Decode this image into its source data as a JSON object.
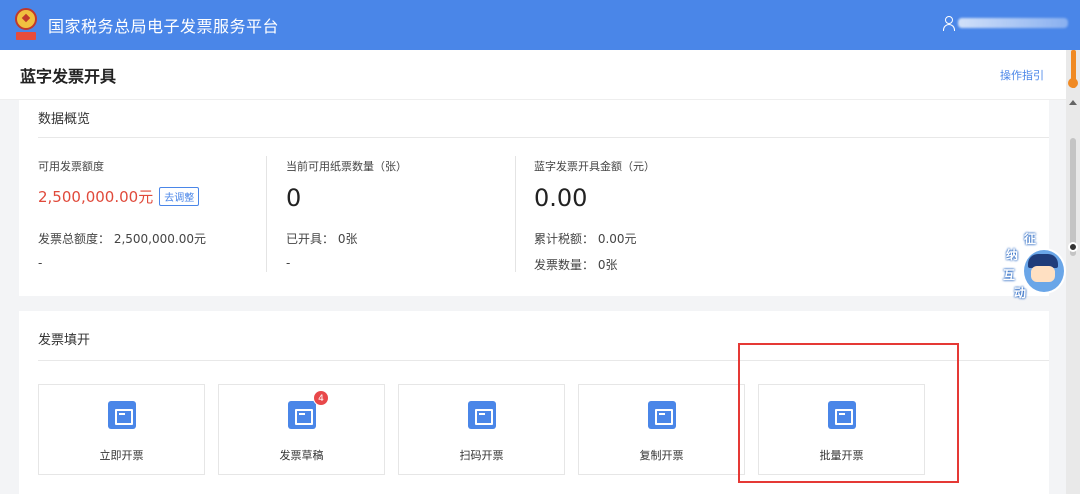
{
  "app": {
    "title": "国家税务总局电子发票服务平台"
  },
  "page": {
    "title": "蓝字发票开具",
    "guide_link": "操作指引"
  },
  "overview": {
    "section_title": "数据概览",
    "col1": {
      "label": "可用发票额度",
      "amount": "2,500,000.00元",
      "adjust_link": "去调整",
      "line1": "发票总额度： 2,500,000.00元",
      "line2": "-"
    },
    "col2": {
      "label": "当前可用纸票数量（张）",
      "big_value": "0",
      "line1": "已开具： 0张",
      "line2": "-"
    },
    "col3": {
      "label": "蓝字发票开具金额（元）",
      "big_value": "0.00",
      "line1": "累计税额： 0.00元",
      "line2": "发票数量： 0张"
    }
  },
  "fill": {
    "section_title": "发票填开",
    "tiles": [
      {
        "label": "立即开票",
        "icon": "invoice-issue-icon"
      },
      {
        "label": "发票草稿",
        "icon": "draft-icon",
        "badge": "4"
      },
      {
        "label": "扫码开票",
        "icon": "qr-code-icon"
      },
      {
        "label": "复制开票",
        "icon": "copy-invoice-icon"
      },
      {
        "label": "批量开票",
        "icon": "batch-invoice-icon"
      }
    ]
  },
  "mascot": {
    "chars": [
      "征",
      "纳",
      "互",
      "动"
    ]
  },
  "colors": {
    "brand": "#4a86e8",
    "accent_red": "#e04a3b",
    "highlight": "#e53935",
    "handle": "#f08a24"
  }
}
